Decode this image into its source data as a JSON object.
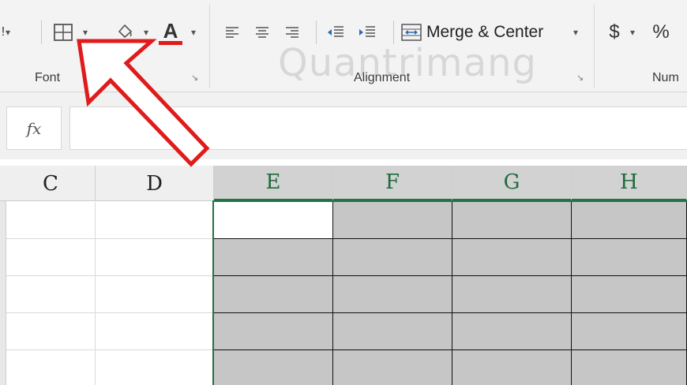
{
  "ribbon": {
    "font_group_label": "Font",
    "alignment_group_label": "Alignment",
    "number_group_label": "Num",
    "merge_center_label": "Merge & Center",
    "currency_symbol": "$",
    "percent_symbol": "%",
    "font_color_letter": "A",
    "launcher_glyph": "↘"
  },
  "formula_bar": {
    "fx_label": "fx",
    "value": ""
  },
  "columns": [
    "C",
    "D",
    "E",
    "F",
    "G",
    "H"
  ],
  "selection": {
    "range_start": "E",
    "range_end": "H"
  },
  "watermark": "Quantrimang",
  "colors": {
    "accent_green": "#217346",
    "selection_fill": "#c6c6c6",
    "arrow_red": "#e01b1b",
    "font_color_underline": "#e01b1b",
    "fill_color_underline": "#ffeb00"
  },
  "icons": [
    "borders-icon",
    "fill-color-icon",
    "font-color-icon",
    "align-left-icon",
    "align-center-icon",
    "align-right-icon",
    "decrease-indent-icon",
    "increase-indent-icon",
    "merge-center-icon",
    "currency-icon",
    "percent-icon",
    "dialog-launcher-icon"
  ]
}
